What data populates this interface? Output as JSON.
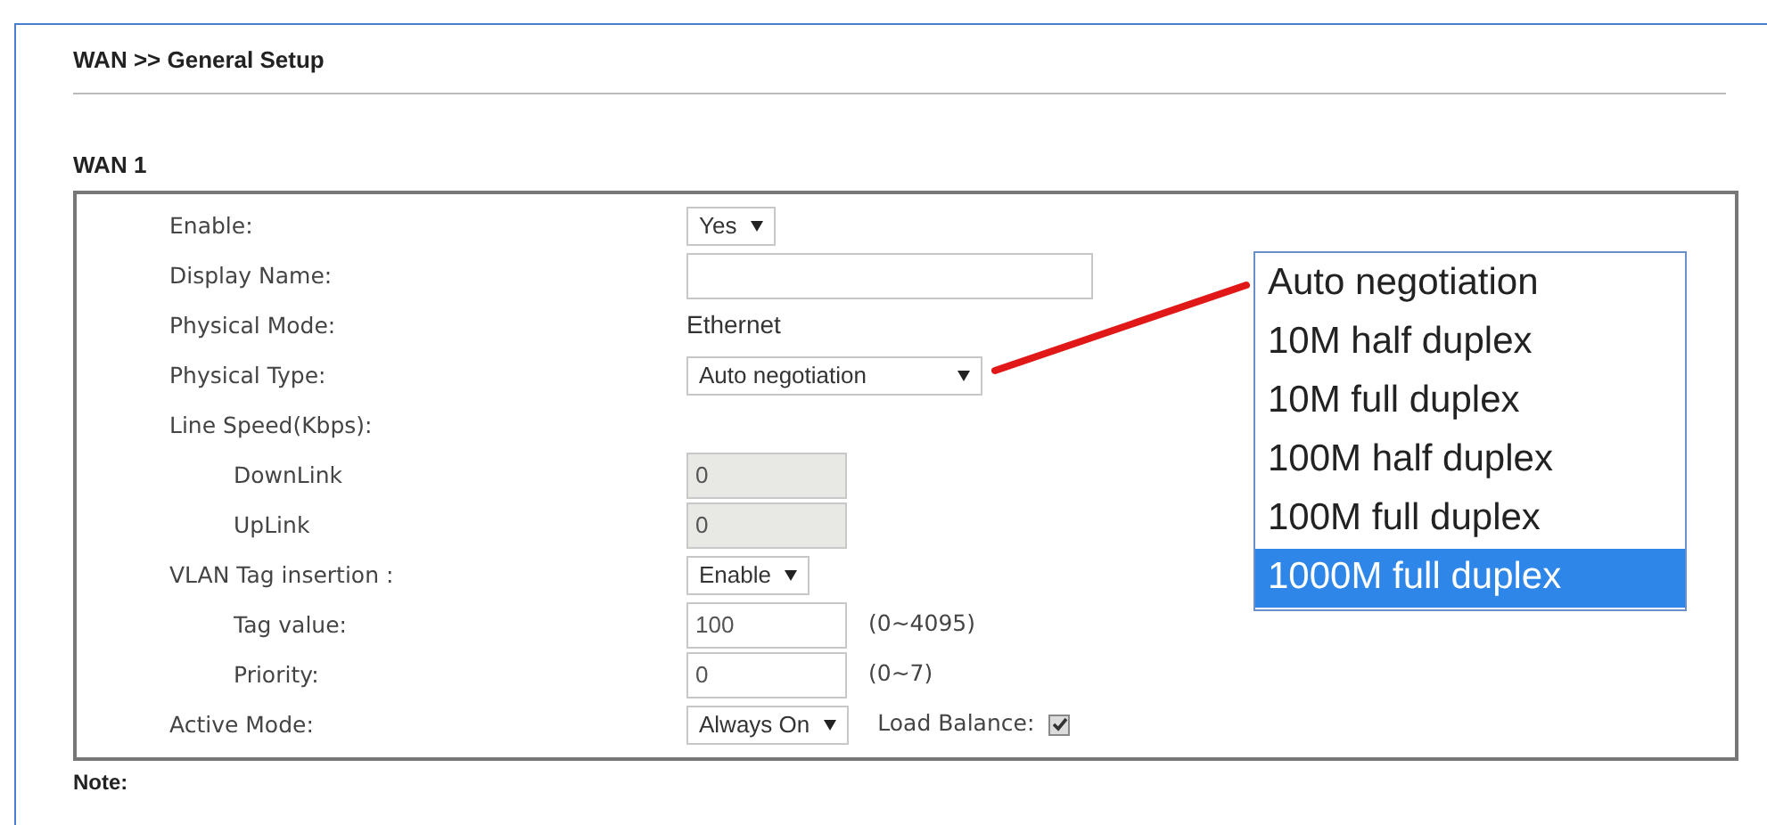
{
  "page_title": "WAN >> General Setup",
  "section_title": "WAN 1",
  "fields": [
    {
      "kind": "select",
      "label": "Enable:",
      "value": "Yes"
    },
    {
      "kind": "input",
      "label": "Display Name:"
    },
    {
      "kind": "text",
      "label": "Physical Mode:",
      "value": "Ethernet"
    },
    {
      "kind": "select",
      "label": "Physical Type:",
      "value": "Auto negotiation",
      "wide": true
    },
    {
      "kind": "heading",
      "label": "Line Speed(Kbps):",
      "children": [
        {
          "kind": "input",
          "label": "DownLink",
          "value": "0",
          "disabled": true
        },
        {
          "kind": "input",
          "label": "UpLink",
          "value": "0",
          "disabled": true
        }
      ]
    },
    {
      "kind": "select",
      "label": "VLAN Tag insertion :",
      "value": "Enable",
      "children": [
        {
          "kind": "input",
          "label": "Tag value:",
          "value": "100",
          "disabled": false,
          "hint": "(0~4095)"
        },
        {
          "kind": "input",
          "label": "Priority:",
          "value": "0",
          "disabled": false,
          "hint": "(0~7)"
        }
      ]
    },
    {
      "kind": "select",
      "label": "Active Mode:",
      "value": "Always On",
      "extra_label": "Load Balance:",
      "checked": true
    }
  ],
  "note": "Note:",
  "dropdown_options": [
    {
      "label": "Auto negotiation",
      "selected": false
    },
    {
      "label": "10M half duplex",
      "selected": false
    },
    {
      "label": "10M full duplex",
      "selected": false
    },
    {
      "label": "100M half duplex",
      "selected": false
    },
    {
      "label": "100M full duplex",
      "selected": false
    },
    {
      "label": "1000M full duplex",
      "selected": true
    }
  ]
}
